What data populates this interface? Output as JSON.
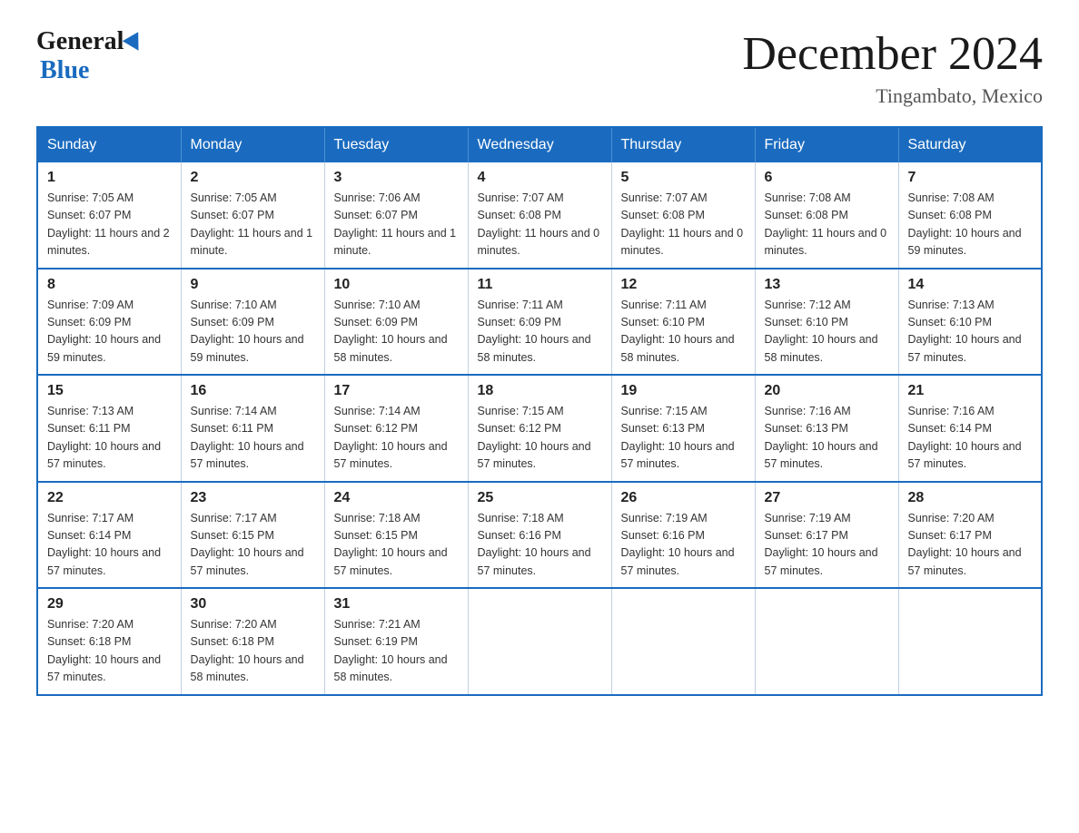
{
  "logo": {
    "general_text": "General",
    "blue_text": "Blue"
  },
  "title": {
    "month_year": "December 2024",
    "location": "Tingambato, Mexico"
  },
  "weekdays": [
    "Sunday",
    "Monday",
    "Tuesday",
    "Wednesday",
    "Thursday",
    "Friday",
    "Saturday"
  ],
  "weeks": [
    [
      {
        "day": 1,
        "sunrise": "7:05 AM",
        "sunset": "6:07 PM",
        "daylight": "11 hours and 2 minutes."
      },
      {
        "day": 2,
        "sunrise": "7:05 AM",
        "sunset": "6:07 PM",
        "daylight": "11 hours and 1 minute."
      },
      {
        "day": 3,
        "sunrise": "7:06 AM",
        "sunset": "6:07 PM",
        "daylight": "11 hours and 1 minute."
      },
      {
        "day": 4,
        "sunrise": "7:07 AM",
        "sunset": "6:08 PM",
        "daylight": "11 hours and 0 minutes."
      },
      {
        "day": 5,
        "sunrise": "7:07 AM",
        "sunset": "6:08 PM",
        "daylight": "11 hours and 0 minutes."
      },
      {
        "day": 6,
        "sunrise": "7:08 AM",
        "sunset": "6:08 PM",
        "daylight": "11 hours and 0 minutes."
      },
      {
        "day": 7,
        "sunrise": "7:08 AM",
        "sunset": "6:08 PM",
        "daylight": "10 hours and 59 minutes."
      }
    ],
    [
      {
        "day": 8,
        "sunrise": "7:09 AM",
        "sunset": "6:09 PM",
        "daylight": "10 hours and 59 minutes."
      },
      {
        "day": 9,
        "sunrise": "7:10 AM",
        "sunset": "6:09 PM",
        "daylight": "10 hours and 59 minutes."
      },
      {
        "day": 10,
        "sunrise": "7:10 AM",
        "sunset": "6:09 PM",
        "daylight": "10 hours and 58 minutes."
      },
      {
        "day": 11,
        "sunrise": "7:11 AM",
        "sunset": "6:09 PM",
        "daylight": "10 hours and 58 minutes."
      },
      {
        "day": 12,
        "sunrise": "7:11 AM",
        "sunset": "6:10 PM",
        "daylight": "10 hours and 58 minutes."
      },
      {
        "day": 13,
        "sunrise": "7:12 AM",
        "sunset": "6:10 PM",
        "daylight": "10 hours and 58 minutes."
      },
      {
        "day": 14,
        "sunrise": "7:13 AM",
        "sunset": "6:10 PM",
        "daylight": "10 hours and 57 minutes."
      }
    ],
    [
      {
        "day": 15,
        "sunrise": "7:13 AM",
        "sunset": "6:11 PM",
        "daylight": "10 hours and 57 minutes."
      },
      {
        "day": 16,
        "sunrise": "7:14 AM",
        "sunset": "6:11 PM",
        "daylight": "10 hours and 57 minutes."
      },
      {
        "day": 17,
        "sunrise": "7:14 AM",
        "sunset": "6:12 PM",
        "daylight": "10 hours and 57 minutes."
      },
      {
        "day": 18,
        "sunrise": "7:15 AM",
        "sunset": "6:12 PM",
        "daylight": "10 hours and 57 minutes."
      },
      {
        "day": 19,
        "sunrise": "7:15 AM",
        "sunset": "6:13 PM",
        "daylight": "10 hours and 57 minutes."
      },
      {
        "day": 20,
        "sunrise": "7:16 AM",
        "sunset": "6:13 PM",
        "daylight": "10 hours and 57 minutes."
      },
      {
        "day": 21,
        "sunrise": "7:16 AM",
        "sunset": "6:14 PM",
        "daylight": "10 hours and 57 minutes."
      }
    ],
    [
      {
        "day": 22,
        "sunrise": "7:17 AM",
        "sunset": "6:14 PM",
        "daylight": "10 hours and 57 minutes."
      },
      {
        "day": 23,
        "sunrise": "7:17 AM",
        "sunset": "6:15 PM",
        "daylight": "10 hours and 57 minutes."
      },
      {
        "day": 24,
        "sunrise": "7:18 AM",
        "sunset": "6:15 PM",
        "daylight": "10 hours and 57 minutes."
      },
      {
        "day": 25,
        "sunrise": "7:18 AM",
        "sunset": "6:16 PM",
        "daylight": "10 hours and 57 minutes."
      },
      {
        "day": 26,
        "sunrise": "7:19 AM",
        "sunset": "6:16 PM",
        "daylight": "10 hours and 57 minutes."
      },
      {
        "day": 27,
        "sunrise": "7:19 AM",
        "sunset": "6:17 PM",
        "daylight": "10 hours and 57 minutes."
      },
      {
        "day": 28,
        "sunrise": "7:20 AM",
        "sunset": "6:17 PM",
        "daylight": "10 hours and 57 minutes."
      }
    ],
    [
      {
        "day": 29,
        "sunrise": "7:20 AM",
        "sunset": "6:18 PM",
        "daylight": "10 hours and 57 minutes."
      },
      {
        "day": 30,
        "sunrise": "7:20 AM",
        "sunset": "6:18 PM",
        "daylight": "10 hours and 58 minutes."
      },
      {
        "day": 31,
        "sunrise": "7:21 AM",
        "sunset": "6:19 PM",
        "daylight": "10 hours and 58 minutes."
      },
      null,
      null,
      null,
      null
    ]
  ]
}
